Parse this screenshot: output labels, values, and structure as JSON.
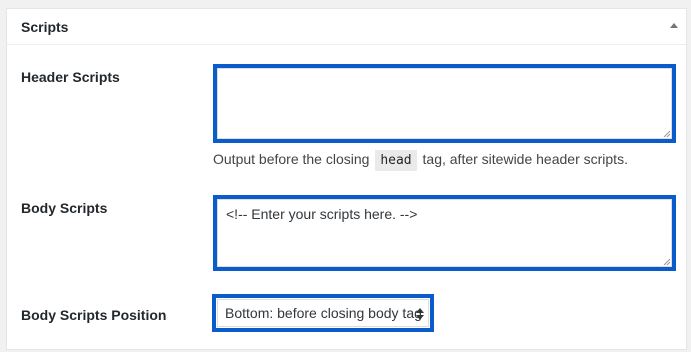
{
  "metabox": {
    "title": "Scripts"
  },
  "header_scripts": {
    "label": "Header Scripts",
    "value": "",
    "description_before": "Output before the closing",
    "description_code": "head",
    "description_after": "tag, after sitewide header scripts."
  },
  "body_scripts": {
    "label": "Body Scripts",
    "value": "<!-- Enter your scripts here. -->"
  },
  "body_scripts_position": {
    "label": "Body Scripts Position",
    "selected": "Bottom: before closing body tag"
  },
  "colors": {
    "highlight_border": "#0a5ccc",
    "metabox_background": "#ffffff",
    "page_background": "#f1f1f1"
  },
  "icons": {
    "toggle": "triangle-up-icon",
    "select": "up-down-arrows-icon",
    "resize": "resize-grip-icon"
  }
}
